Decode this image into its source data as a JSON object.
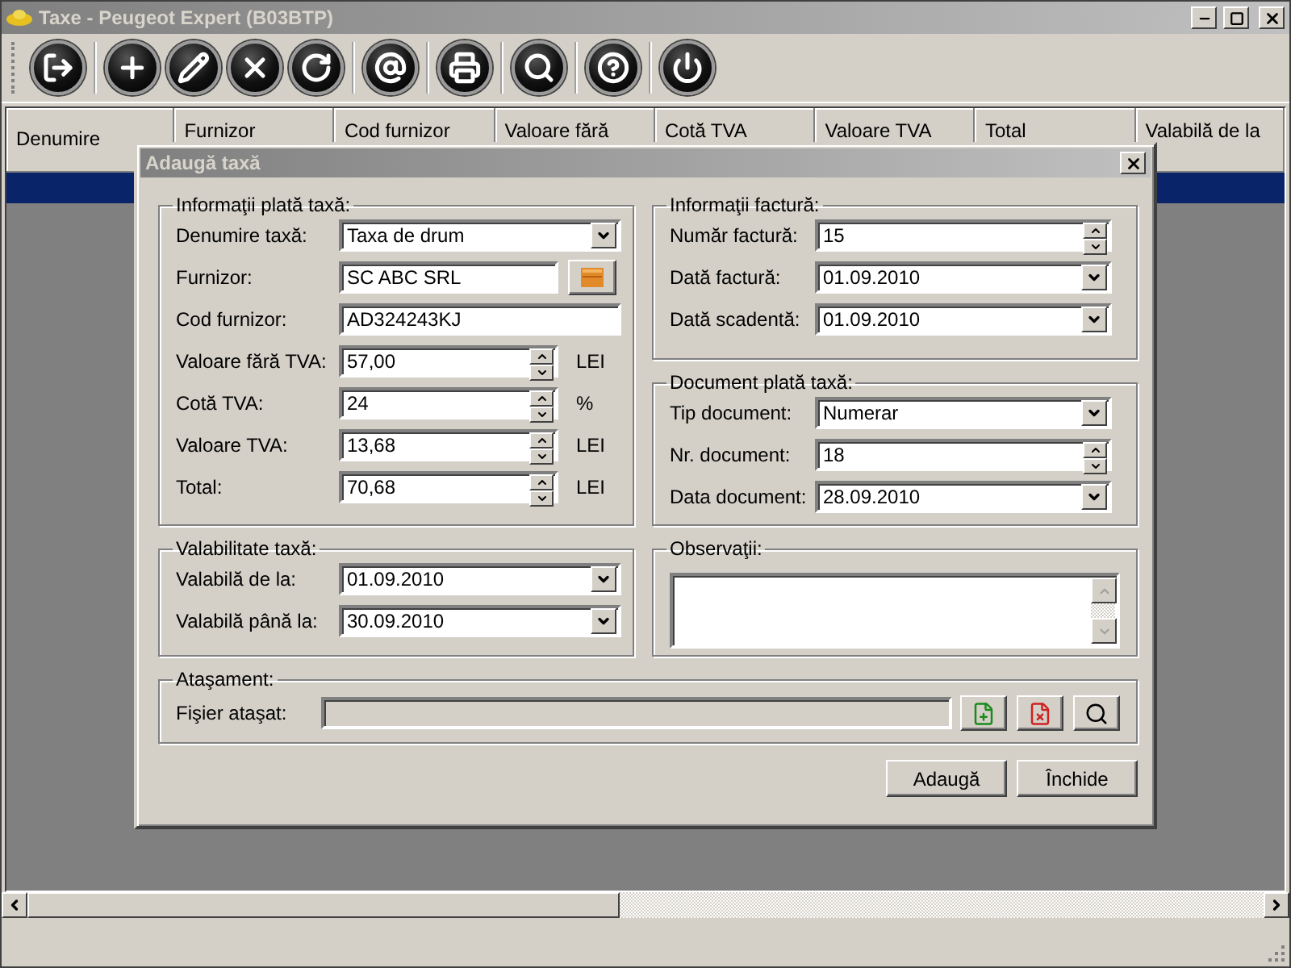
{
  "window": {
    "title": "Taxe - Peugeot Expert (B03BTP)"
  },
  "table": {
    "columns": [
      "Denumire",
      "Furnizor",
      "Cod furnizor",
      "Valoare fără",
      "Cotă TVA",
      "Valoare TVA",
      "Total",
      "Valabilă de la"
    ],
    "rows": [
      {
        "selected": true
      }
    ]
  },
  "dialog": {
    "title": "Adaugă taxă",
    "groups": [
      {
        "title": "Informaţii plată taxă:",
        "fields": [
          {
            "label": "Denumire taxă:",
            "kind": "combo",
            "value": "Taxa de drum"
          },
          {
            "label": "Furnizor:",
            "kind": "lookup",
            "value": "SC ABC SRL"
          },
          {
            "label": "Cod furnizor:",
            "kind": "text",
            "value": "AD324243KJ"
          },
          {
            "label": "Valoare fără TVA:",
            "kind": "spin",
            "value": "57,00",
            "unit": "LEI"
          },
          {
            "label": "Cotă TVA:",
            "kind": "spin",
            "value": "24",
            "unit": "%"
          },
          {
            "label": "Valoare TVA:",
            "kind": "spin",
            "value": "13,68",
            "unit": "LEI"
          },
          {
            "label": "Total:",
            "kind": "spin",
            "value": "70,68",
            "unit": "LEI"
          }
        ]
      },
      {
        "title": "Informaţii factură:",
        "fields": [
          {
            "label": "Număr factură:",
            "kind": "spin",
            "value": "15"
          },
          {
            "label": "Dată factură:",
            "kind": "combo",
            "value": "01.09.2010"
          },
          {
            "label": "Dată scadentă:",
            "kind": "combo",
            "value": "01.09.2010"
          }
        ]
      },
      {
        "title": "Document plată taxă:",
        "fields": [
          {
            "label": "Tip document:",
            "kind": "combo",
            "value": "Numerar"
          },
          {
            "label": "Nr. document:",
            "kind": "spin",
            "value": "18"
          },
          {
            "label": "Data document:",
            "kind": "combo",
            "value": "28.09.2010"
          }
        ]
      },
      {
        "title": "Valabilitate taxă:",
        "fields": [
          {
            "label": "Valabilă de la:",
            "kind": "combo",
            "value": "01.09.2010"
          },
          {
            "label": "Valabilă până la:",
            "kind": "combo",
            "value": "30.09.2010"
          }
        ]
      },
      {
        "title": "Observaţii:",
        "fields": [
          {
            "kind": "memo"
          }
        ]
      },
      {
        "title": "Ataşament:",
        "fields": [
          {
            "label": "Fişier ataşat:",
            "kind": "file"
          }
        ]
      }
    ],
    "buttons": [
      "Adaugă",
      "Închide"
    ]
  }
}
